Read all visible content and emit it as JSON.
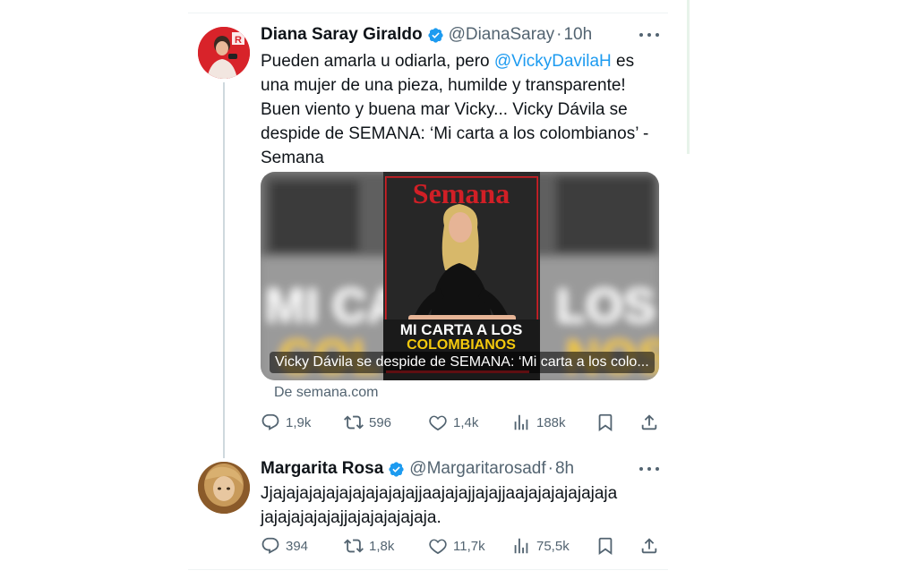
{
  "tweets": [
    {
      "name": "Diana Saray Giraldo",
      "handle": "@DianaSaray",
      "separator": "·",
      "time": "10h",
      "text_before": "Pueden amarla u odiarla, pero ",
      "mention": "@VickyDavilaH",
      "text_after": " es una mujer de una pieza, humilde y transparente! Buen viento y buena mar Vicky... Vicky Dávila se despide de SEMANA: ‘Mi carta a los colombianos’ - Semana",
      "card": {
        "magazine_title": "Semana",
        "headline_line1": "MI CARTA A LOS",
        "headline_line2": "COLOMBIANOS",
        "bg_text_1": "MI CA",
        "bg_text_2": "COL",
        "bg_text_3": "LOS",
        "bg_text_4": "NOS",
        "overlay_title": "Vicky Dávila se despide de SEMANA: ‘Mi carta a los colo...",
        "source": "De semana.com"
      },
      "stats": {
        "replies": "1,9k",
        "retweets": "596",
        "likes": "1,4k",
        "views": "188k"
      }
    },
    {
      "name": "Margarita Rosa",
      "handle": "@Margaritarosadf",
      "separator": "·",
      "time": "8h",
      "text": "Jjajajajajajajajajajajajjaajajajjajajjaajajajajajajaja jajajajajajajjajajajajajaja.",
      "stats": {
        "replies": "394",
        "retweets": "1,8k",
        "likes": "11,7k",
        "views": "75,5k"
      }
    }
  ],
  "colors": {
    "text": "#0f1419",
    "secondary": "#536471",
    "link": "#1d9bf0",
    "verified": "#1d9bf0",
    "magazine_red": "#d11f26",
    "headline_yellow": "#f4c90d"
  },
  "icons": [
    "verified-badge-icon",
    "more-icon",
    "reply-icon",
    "retweet-icon",
    "like-icon",
    "views-icon",
    "bookmark-icon",
    "share-icon"
  ]
}
